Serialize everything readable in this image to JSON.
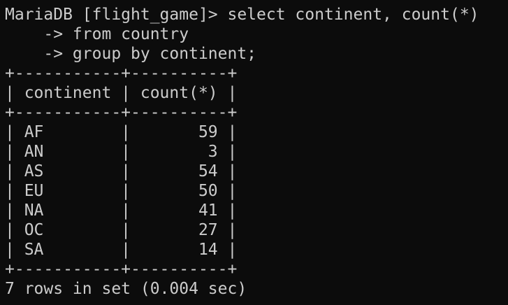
{
  "terminal": {
    "query": {
      "prompt_line": "MariaDB [flight_game]> select continent, count(*)",
      "line2": "    -> from country",
      "line3": "    -> group by continent;"
    },
    "table": {
      "border": "+-----------+----------+",
      "header": "| continent | count(*) |",
      "rows": [
        "| AF        |       59 |",
        "| AN        |        3 |",
        "| AS        |       54 |",
        "| EU        |       50 |",
        "| NA        |       41 |",
        "| OC        |       27 |",
        "| SA        |       14 |"
      ]
    },
    "summary": "7 rows in set (0.004 sec)",
    "colors": {
      "background": "#0c0c0c",
      "text": "#cccccc"
    }
  }
}
